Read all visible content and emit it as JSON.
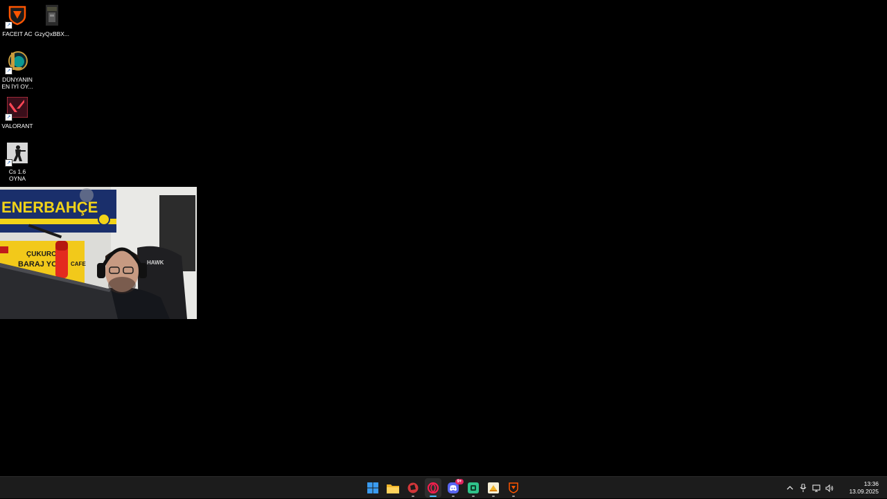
{
  "desktop": {
    "icons": [
      {
        "label": "FACEIT AC",
        "icon": "faceit-ac-icon"
      },
      {
        "label": "GzyQxBBX...",
        "icon": "file-thumbnail-icon"
      },
      {
        "label": "DÜNYANIN\nEN İYİ OY...",
        "icon": "league-of-legends-icon"
      },
      {
        "label": "VALORANT",
        "icon": "valorant-icon"
      },
      {
        "label": "Cs 1.6 OYNA",
        "icon": "counter-strike-icon"
      }
    ],
    "background_color": "#000000"
  },
  "webcam": {
    "banner_text": "ENERBAHÇE",
    "sign_text_1": "ÇUKUROV",
    "sign_text_2": "BARAJ YOLU",
    "sign_text_3": "CAFE",
    "chair_text": "HAWK"
  },
  "taskbar": {
    "apps": [
      {
        "name": "start-button",
        "icon": "windows-logo-icon"
      },
      {
        "name": "file-explorer",
        "icon": "folder-icon"
      },
      {
        "name": "riot-client",
        "icon": "riot-icon"
      },
      {
        "name": "opera-gx",
        "icon": "opera-gx-icon",
        "active": true
      },
      {
        "name": "discord",
        "icon": "discord-icon",
        "badge": "9+"
      },
      {
        "name": "app-green",
        "icon": "green-app-icon"
      },
      {
        "name": "app-yellow",
        "icon": "yellow-app-icon"
      },
      {
        "name": "faceit",
        "icon": "faceit-icon"
      }
    ],
    "tray": {
      "time": "13:36",
      "date": "13.09.2025"
    }
  }
}
